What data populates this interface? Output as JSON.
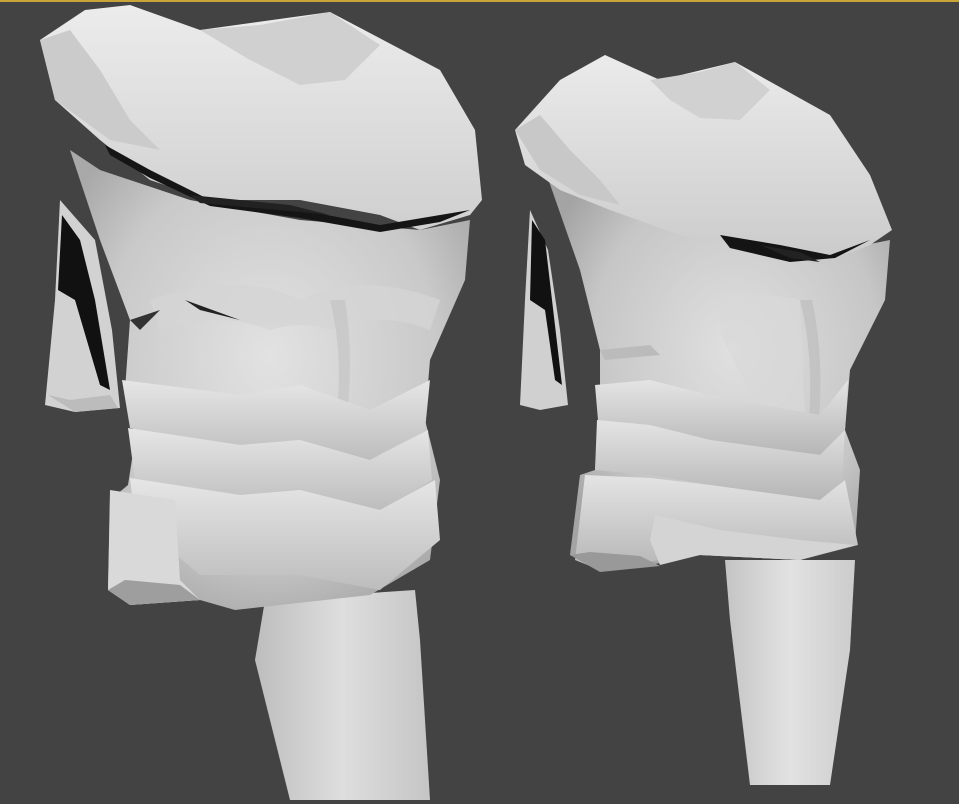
{
  "viewport": {
    "label": "",
    "active_border_color": "#c9a437",
    "background_color": "#434343",
    "shading": "gray clay"
  },
  "models": [
    {
      "name": "torso-armor-front-view"
    },
    {
      "name": "torso-armor-three-quarter-view"
    }
  ]
}
